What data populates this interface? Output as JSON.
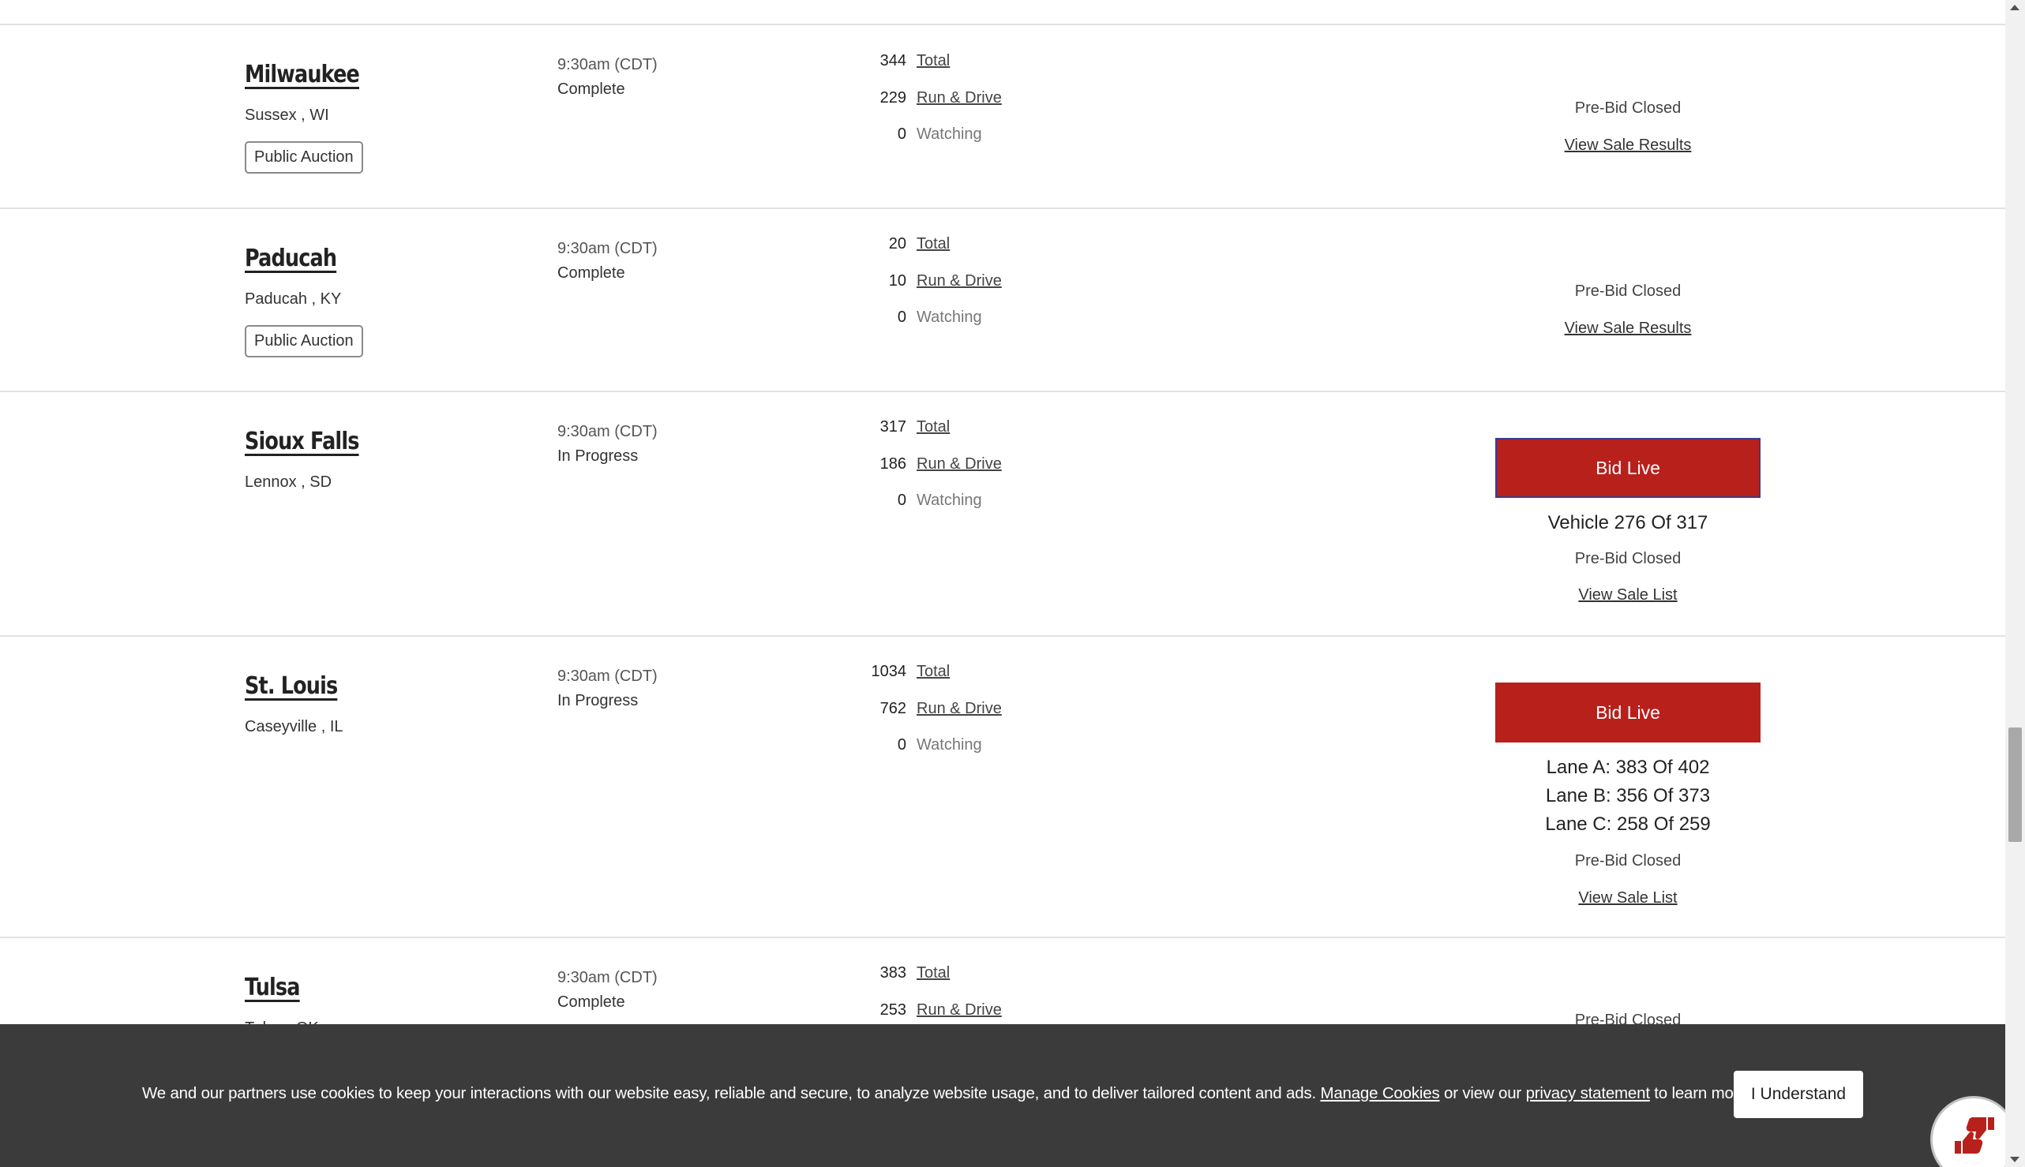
{
  "rows": [
    {
      "city": "Milwaukee",
      "location": "Sussex , WI",
      "tag": "Public Auction",
      "time": "9:30am (CDT)",
      "status": "Complete",
      "total": "344",
      "total_label": "Total",
      "run_drive": "229",
      "run_drive_label": "Run & Drive",
      "watching": "0",
      "watching_label": "Watching",
      "prebid": "Pre-Bid Closed",
      "link": "View Sale Results"
    },
    {
      "city": "Paducah",
      "location": "Paducah , KY",
      "tag": "Public Auction",
      "time": "9:30am (CDT)",
      "status": "Complete",
      "total": "20",
      "total_label": "Total",
      "run_drive": "10",
      "run_drive_label": "Run & Drive",
      "watching": "0",
      "watching_label": "Watching",
      "prebid": "Pre-Bid Closed",
      "link": "View Sale Results"
    },
    {
      "city": "Sioux Falls",
      "location": "Lennox , SD",
      "time": "9:30am (CDT)",
      "status": "In Progress",
      "total": "317",
      "total_label": "Total",
      "run_drive": "186",
      "run_drive_label": "Run & Drive",
      "watching": "0",
      "watching_label": "Watching",
      "bid_button": "Bid Live",
      "progress": [
        "Vehicle 276 Of 317"
      ],
      "prebid": "Pre-Bid Closed",
      "link": "View Sale List"
    },
    {
      "city": "St. Louis",
      "location": "Caseyville , IL",
      "time": "9:30am (CDT)",
      "status": "In Progress",
      "total": "1034",
      "total_label": "Total",
      "run_drive": "762",
      "run_drive_label": "Run & Drive",
      "watching": "0",
      "watching_label": "Watching",
      "bid_button": "Bid Live",
      "progress": [
        "Lane A: 383 Of 402",
        "Lane B: 356 Of 373",
        "Lane C: 258 Of 259"
      ],
      "prebid": "Pre-Bid Closed",
      "link": "View Sale List"
    },
    {
      "city": "Tulsa",
      "location": "Tulsa , OK",
      "time": "9:30am (CDT)",
      "status": "Complete",
      "total": "383",
      "total_label": "Total",
      "run_drive": "253",
      "run_drive_label": "Run & Drive",
      "prebid": "Pre-Bid Closed"
    }
  ],
  "cookie": {
    "text_before": "We and our partners use cookies to keep your interactions with our website easy, reliable and secure, to analyze website usage, and to deliver tailored content and ads. ",
    "manage_link": "Manage Cookies",
    "text_middle": " or view our ",
    "privacy_link": "privacy statement",
    "text_after": " to learn more.",
    "button": "I Understand"
  },
  "colors": {
    "accent": "#b8201c",
    "banner": "#3b3b3b"
  },
  "icons": {
    "feedback": "thumbs-up-down-icon"
  }
}
